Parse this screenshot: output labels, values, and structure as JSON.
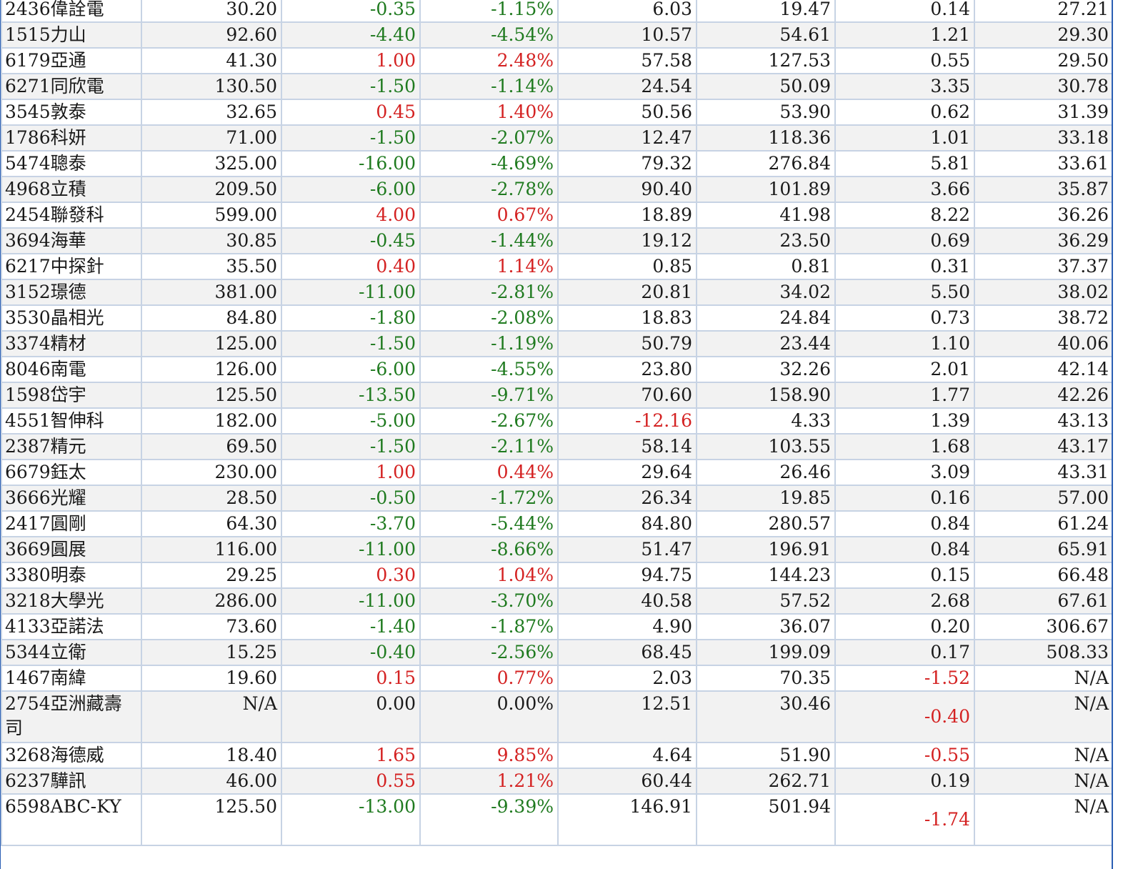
{
  "colors": {
    "down": "#1f7a1f",
    "up": "#d42222",
    "frame": "#2a5fb4",
    "grid": "#c7d3e4",
    "stripe": "#f2f2f2"
  },
  "rows": [
    {
      "name": "2436偉詮電",
      "price": "30.20",
      "change": "-0.35",
      "pct": "-1.15%",
      "c4": "6.03",
      "c5": "19.47",
      "c6": "0.14",
      "c7": "27.21"
    },
    {
      "name": "1515力山",
      "price": "92.60",
      "change": "-4.40",
      "pct": "-4.54%",
      "c4": "10.57",
      "c5": "54.61",
      "c6": "1.21",
      "c7": "29.30"
    },
    {
      "name": "6179亞通",
      "price": "41.30",
      "change": "1.00",
      "pct": "2.48%",
      "c4": "57.58",
      "c5": "127.53",
      "c6": "0.55",
      "c7": "29.50"
    },
    {
      "name": "6271同欣電",
      "price": "130.50",
      "change": "-1.50",
      "pct": "-1.14%",
      "c4": "24.54",
      "c5": "50.09",
      "c6": "3.35",
      "c7": "30.78"
    },
    {
      "name": "3545敦泰",
      "price": "32.65",
      "change": "0.45",
      "pct": "1.40%",
      "c4": "50.56",
      "c5": "53.90",
      "c6": "0.62",
      "c7": "31.39"
    },
    {
      "name": "1786科妍",
      "price": "71.00",
      "change": "-1.50",
      "pct": "-2.07%",
      "c4": "12.47",
      "c5": "118.36",
      "c6": "1.01",
      "c7": "33.18"
    },
    {
      "name": "5474聰泰",
      "price": "325.00",
      "change": "-16.00",
      "pct": "-4.69%",
      "c4": "79.32",
      "c5": "276.84",
      "c6": "5.81",
      "c7": "33.61"
    },
    {
      "name": "4968立積",
      "price": "209.50",
      "change": "-6.00",
      "pct": "-2.78%",
      "c4": "90.40",
      "c5": "101.89",
      "c6": "3.66",
      "c7": "35.87"
    },
    {
      "name": "2454聯發科",
      "price": "599.00",
      "change": "4.00",
      "pct": "0.67%",
      "c4": "18.89",
      "c5": "41.98",
      "c6": "8.22",
      "c7": "36.26"
    },
    {
      "name": "3694海華",
      "price": "30.85",
      "change": "-0.45",
      "pct": "-1.44%",
      "c4": "19.12",
      "c5": "23.50",
      "c6": "0.69",
      "c7": "36.29"
    },
    {
      "name": "6217中探針",
      "price": "35.50",
      "change": "0.40",
      "pct": "1.14%",
      "c4": "0.85",
      "c5": "0.81",
      "c6": "0.31",
      "c7": "37.37"
    },
    {
      "name": "3152璟德",
      "price": "381.00",
      "change": "-11.00",
      "pct": "-2.81%",
      "c4": "20.81",
      "c5": "34.02",
      "c6": "5.50",
      "c7": "38.02"
    },
    {
      "name": "3530晶相光",
      "price": "84.80",
      "change": "-1.80",
      "pct": "-2.08%",
      "c4": "18.83",
      "c5": "24.84",
      "c6": "0.73",
      "c7": "38.72"
    },
    {
      "name": "3374精材",
      "price": "125.00",
      "change": "-1.50",
      "pct": "-1.19%",
      "c4": "50.79",
      "c5": "23.44",
      "c6": "1.10",
      "c7": "40.06"
    },
    {
      "name": "8046南電",
      "price": "126.00",
      "change": "-6.00",
      "pct": "-4.55%",
      "c4": "23.80",
      "c5": "32.26",
      "c6": "2.01",
      "c7": "42.14"
    },
    {
      "name": "1598岱宇",
      "price": "125.50",
      "change": "-13.50",
      "pct": "-9.71%",
      "c4": "70.60",
      "c5": "158.90",
      "c6": "1.77",
      "c7": "42.26"
    },
    {
      "name": "4551智伸科",
      "price": "182.00",
      "change": "-5.00",
      "pct": "-2.67%",
      "c4": "-12.16",
      "c5": "4.33",
      "c6": "1.39",
      "c7": "43.13"
    },
    {
      "name": "2387精元",
      "price": "69.50",
      "change": "-1.50",
      "pct": "-2.11%",
      "c4": "58.14",
      "c5": "103.55",
      "c6": "1.68",
      "c7": "43.17"
    },
    {
      "name": "6679鈺太",
      "price": "230.00",
      "change": "1.00",
      "pct": "0.44%",
      "c4": "29.64",
      "c5": "26.46",
      "c6": "3.09",
      "c7": "43.31"
    },
    {
      "name": "3666光耀",
      "price": "28.50",
      "change": "-0.50",
      "pct": "-1.72%",
      "c4": "26.34",
      "c5": "19.85",
      "c6": "0.16",
      "c7": "57.00"
    },
    {
      "name": "2417圓剛",
      "price": "64.30",
      "change": "-3.70",
      "pct": "-5.44%",
      "c4": "84.80",
      "c5": "280.57",
      "c6": "0.84",
      "c7": "61.24"
    },
    {
      "name": "3669圓展",
      "price": "116.00",
      "change": "-11.00",
      "pct": "-8.66%",
      "c4": "51.47",
      "c5": "196.91",
      "c6": "0.84",
      "c7": "65.91"
    },
    {
      "name": "3380明泰",
      "price": "29.25",
      "change": "0.30",
      "pct": "1.04%",
      "c4": "94.75",
      "c5": "144.23",
      "c6": "0.15",
      "c7": "66.48"
    },
    {
      "name": "3218大學光",
      "price": "286.00",
      "change": "-11.00",
      "pct": "-3.70%",
      "c4": "40.58",
      "c5": "57.52",
      "c6": "2.68",
      "c7": "67.61"
    },
    {
      "name": "4133亞諾法",
      "price": "73.60",
      "change": "-1.40",
      "pct": "-1.87%",
      "c4": "4.90",
      "c5": "36.07",
      "c6": "0.20",
      "c7": "306.67"
    },
    {
      "name": "5344立衛",
      "price": "15.25",
      "change": "-0.40",
      "pct": "-2.56%",
      "c4": "68.45",
      "c5": "199.09",
      "c6": "0.17",
      "c7": "508.33"
    },
    {
      "name": "1467南緯",
      "price": "19.60",
      "change": "0.15",
      "pct": "0.77%",
      "c4": "2.03",
      "c5": "70.35",
      "c6": "-1.52",
      "c7": "N/A"
    },
    {
      "name": "2754亞洲藏壽司",
      "price": "N/A",
      "change": "0.00",
      "pct": "0.00%",
      "c4": "12.51",
      "c5": "30.46",
      "c6": "-0.40",
      "c7": "N/A"
    },
    {
      "name": "3268海德威",
      "price": "18.40",
      "change": "1.65",
      "pct": "9.85%",
      "c4": "4.64",
      "c5": "51.90",
      "c6": "-0.55",
      "c7": "N/A"
    },
    {
      "name": "6237驊訊",
      "price": "46.00",
      "change": "0.55",
      "pct": "1.21%",
      "c4": "60.44",
      "c5": "262.71",
      "c6": "0.19",
      "c7": "N/A"
    },
    {
      "name": "6598ABC-KY",
      "price": "125.50",
      "change": "-13.00",
      "pct": "-9.39%",
      "c4": "146.91",
      "c5": "501.94",
      "c6": "-1.74",
      "c7": "N/A"
    }
  ]
}
